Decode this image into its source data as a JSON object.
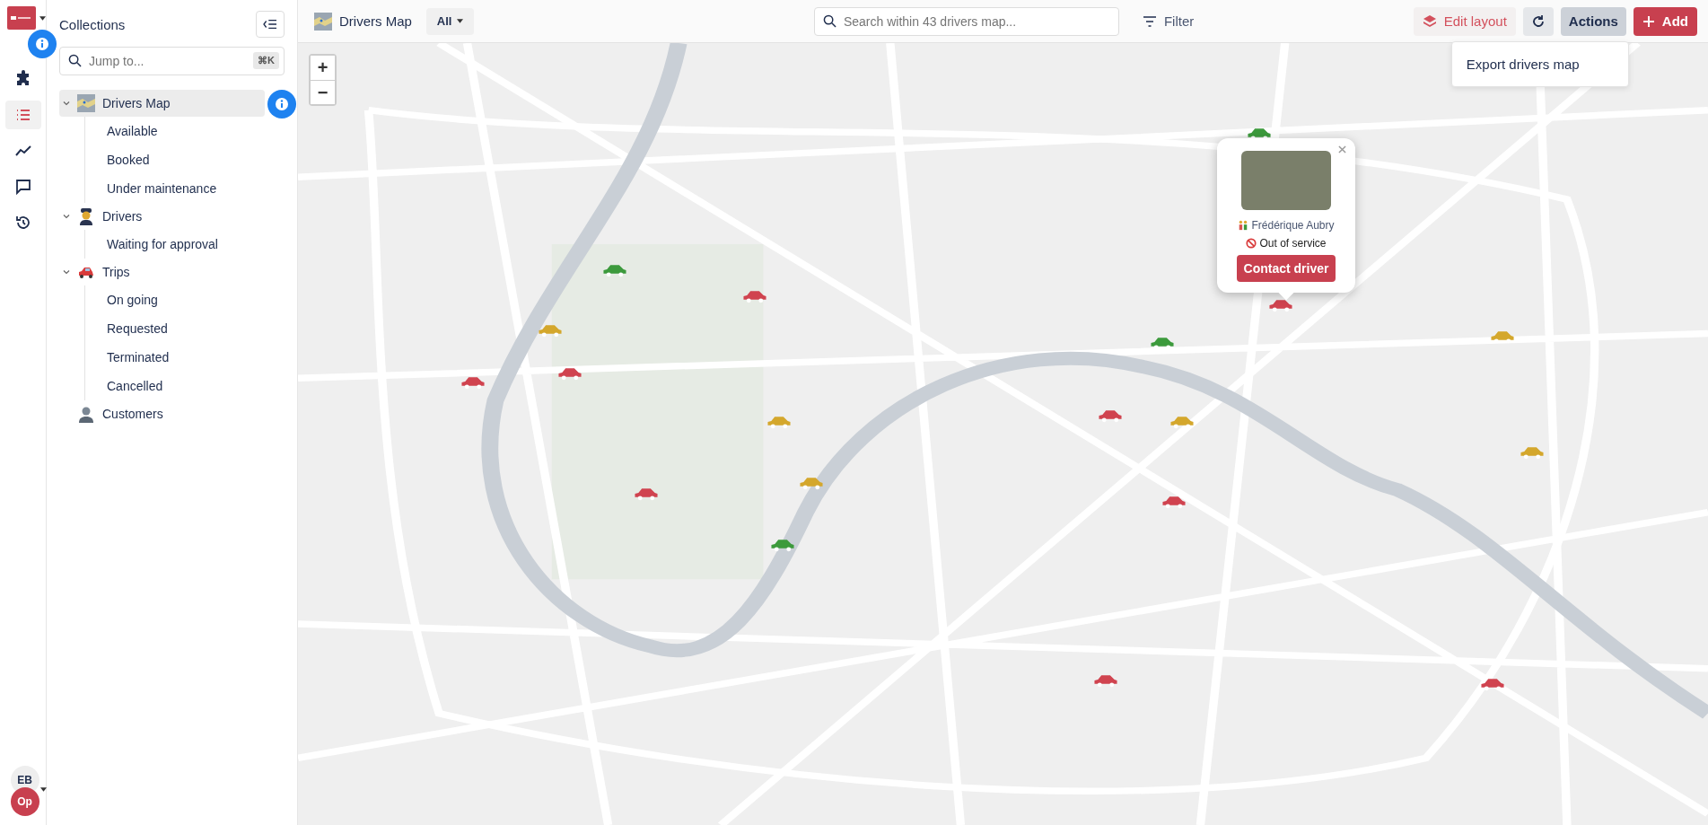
{
  "rail": {
    "items": [
      {
        "selected": false
      },
      {
        "selected": true
      },
      {
        "selected": false
      },
      {
        "selected": false
      },
      {
        "selected": false
      }
    ],
    "avatars": [
      "EB",
      "Op"
    ]
  },
  "sidebar": {
    "title": "Collections",
    "search": {
      "placeholder": "Jump to...",
      "shortcut": "⌘K"
    },
    "items": [
      {
        "label": "Drivers Map",
        "expanded": true,
        "selected": true,
        "children": [
          {
            "label": "Available",
            "selected": false
          },
          {
            "label": "Booked",
            "selected": false
          },
          {
            "label": "Under maintenance",
            "selected": false
          }
        ]
      },
      {
        "label": "Drivers",
        "expanded": true,
        "selected": false,
        "children": [
          {
            "label": "Waiting for approval",
            "selected": false
          }
        ]
      },
      {
        "label": "Trips",
        "expanded": true,
        "selected": false,
        "children": [
          {
            "label": "On going",
            "selected": false
          },
          {
            "label": "Requested",
            "selected": false
          },
          {
            "label": "Terminated",
            "selected": false
          },
          {
            "label": "Cancelled",
            "selected": false
          }
        ]
      },
      {
        "label": "Customers",
        "selected": false
      }
    ]
  },
  "toolbar": {
    "title": "Drivers Map",
    "scope": "All",
    "search": {
      "placeholder": "Search within 43 drivers map..."
    },
    "filter": "Filter",
    "edit_layout": "Edit layout",
    "actions": {
      "label": "Actions",
      "expanded": true,
      "menu": [
        "Export drivers map"
      ]
    },
    "add": "Add"
  },
  "map": {
    "zoom": [
      "+",
      "−"
    ],
    "markers": [
      {
        "color": "#3c9a3c"
      },
      {
        "color": "#3c9a3c"
      },
      {
        "color": "#d0434f"
      },
      {
        "color": "#d4a72c"
      },
      {
        "color": "#d0434f"
      },
      {
        "color": "#d0434f"
      },
      {
        "color": "#d0434f"
      },
      {
        "color": "#3c9a3c"
      },
      {
        "color": "#d4a72c"
      },
      {
        "color": "#d0434f"
      },
      {
        "color": "#d4a72c"
      },
      {
        "color": "#d4a72c"
      },
      {
        "color": "#d4a72c"
      },
      {
        "color": "#d0434f"
      },
      {
        "color": "#d0434f"
      },
      {
        "color": "#d4a72c"
      },
      {
        "color": "#3c9a3c"
      },
      {
        "color": "#d0434f"
      },
      {
        "color": "#d0434f"
      }
    ],
    "popup": {
      "name": "Frédérique Aubry",
      "status": "Out of service",
      "button": "Contact driver"
    }
  }
}
